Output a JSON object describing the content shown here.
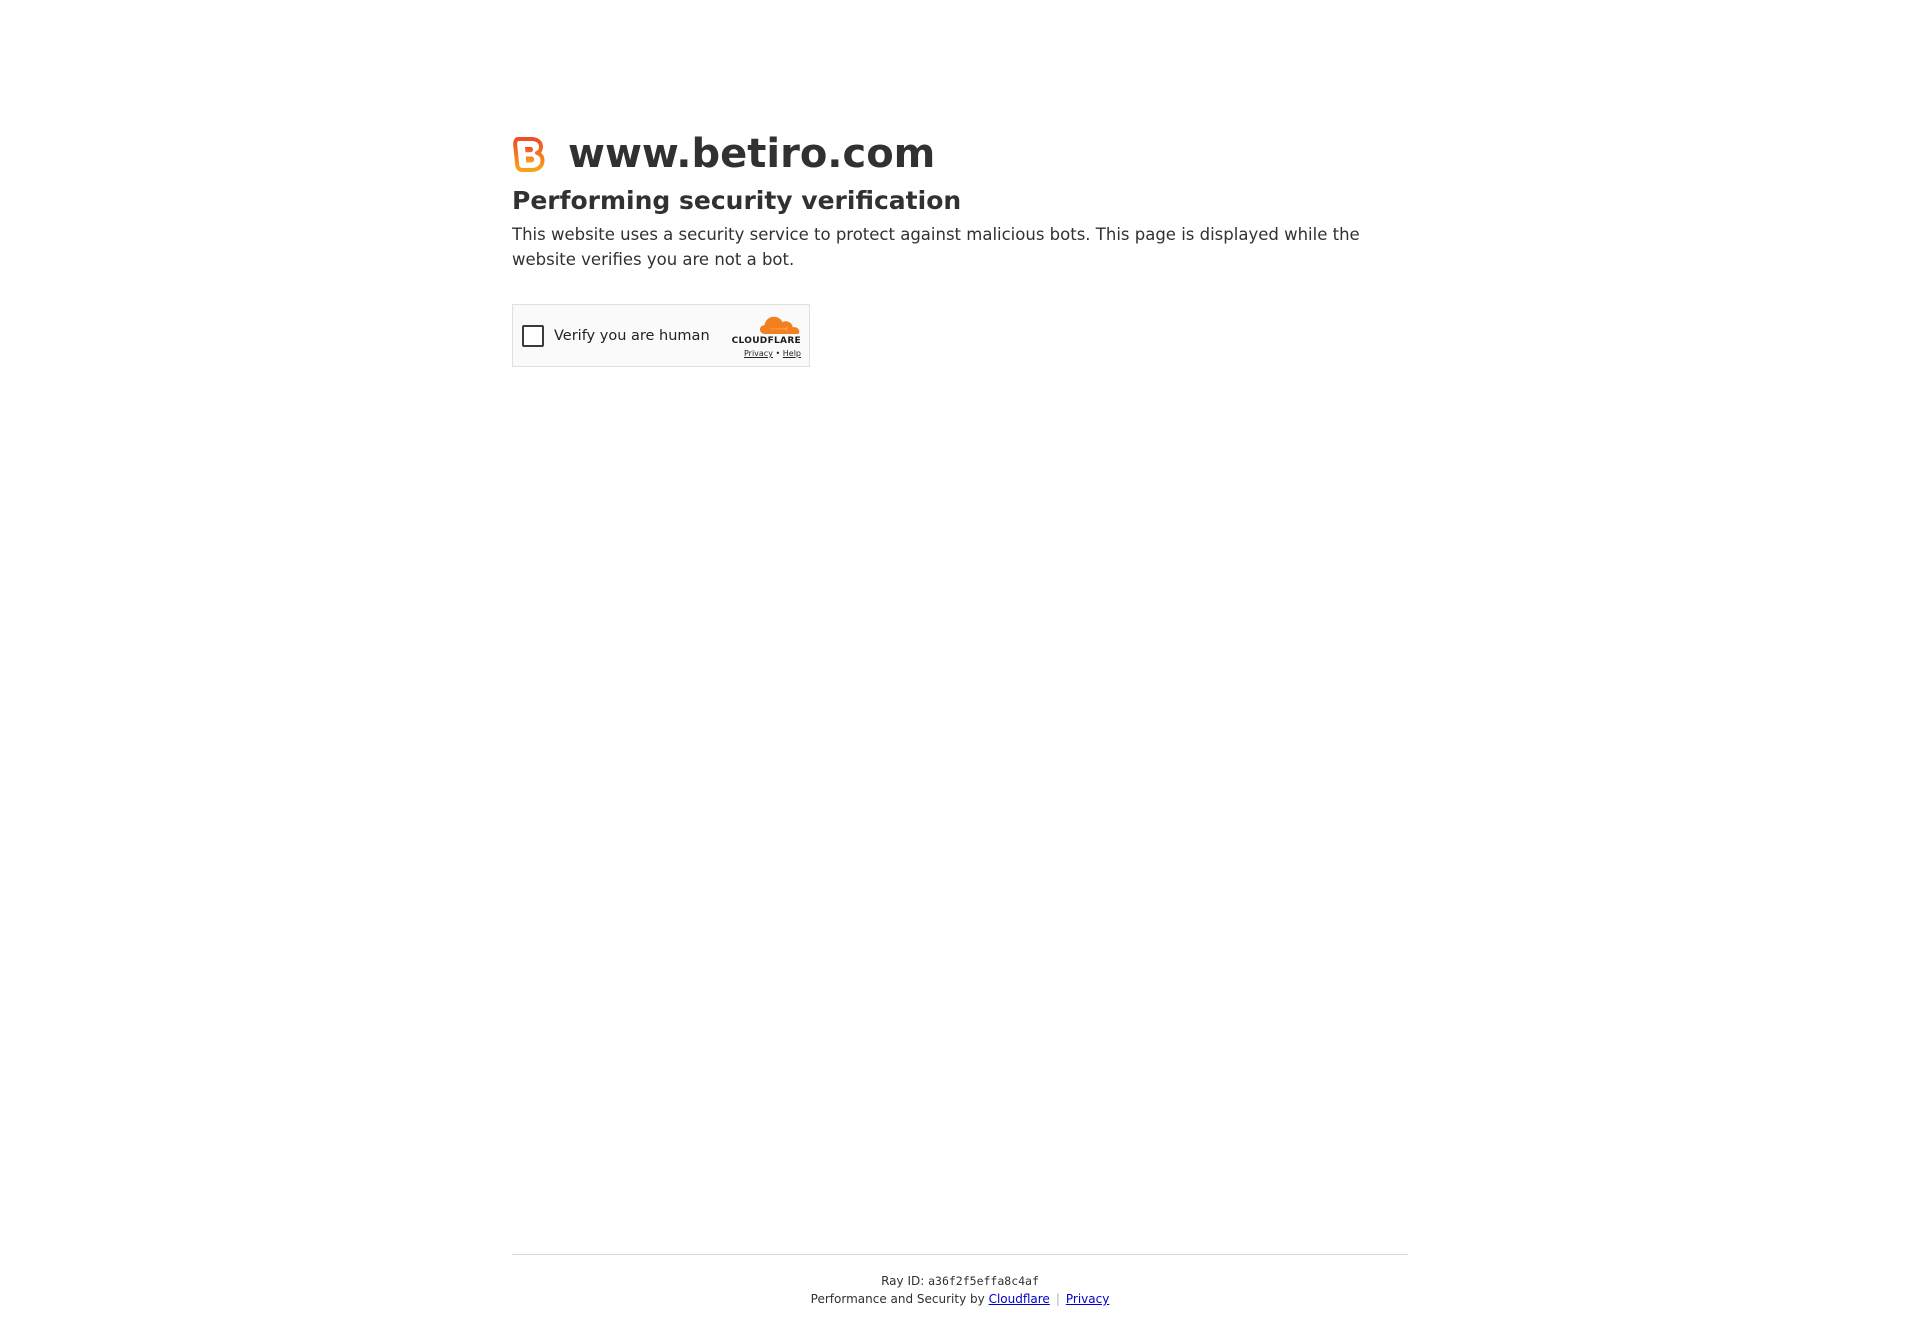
{
  "site": {
    "domain": "www.betiro.com",
    "logo_icon": "betiro-b-logo-icon",
    "accent_color": "#f26a1b"
  },
  "verification": {
    "title": "Performing security verification",
    "description": "This website uses a security service to protect against malicious bots. This page is displayed while the website verifies you are not a bot."
  },
  "widget": {
    "checkbox_checked": false,
    "label": "Verify you are human",
    "brand": "CLOUDFLARE",
    "brand_icon": "cloudflare-cloud-icon",
    "brand_color": "#f38020",
    "privacy_link": "Privacy",
    "link_separator": "•",
    "help_link": "Help"
  },
  "footer": {
    "ray_label": "Ray ID:",
    "ray_id": "a36f2f5effa8c4af",
    "performance_text": "Performance and Security by",
    "cloudflare_link": "Cloudflare",
    "separator": "|",
    "privacy_link": "Privacy"
  }
}
